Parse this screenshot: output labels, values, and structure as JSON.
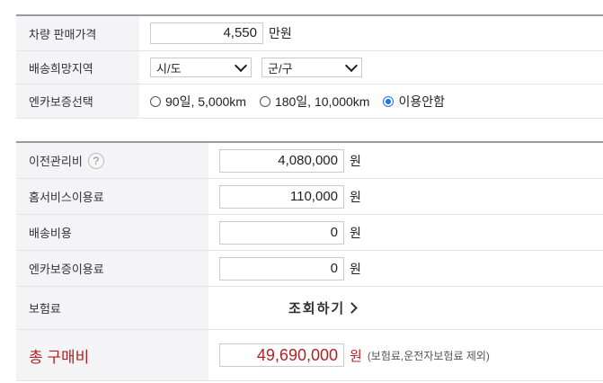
{
  "vehicle": {
    "price_label": "차량 판매가격",
    "price_value": "4,550",
    "price_unit": "만원",
    "region_label": "배송희망지역",
    "region_select1": "시/도",
    "region_select2": "군/구",
    "warranty_label": "엔카보증선택",
    "warranty_options": [
      "90일, 5,000km",
      "180일, 10,000km",
      "이용안함"
    ],
    "warranty_selected": "이용안함"
  },
  "fees": {
    "transfer_label": "이전관리비",
    "transfer_help": "?",
    "transfer_value": "4,080,000",
    "home_service_label": "홈서비스이용료",
    "home_service_value": "110,000",
    "delivery_label": "배송비용",
    "delivery_value": "0",
    "warranty_fee_label": "엔카보증이용료",
    "warranty_fee_value": "0",
    "insurance_label": "보험료",
    "insurance_link": "조회하기",
    "currency": "원"
  },
  "total": {
    "label": "총 구매비",
    "value": "49,690,000",
    "unit": "원",
    "note": "(보험료,운전자보험료 제외)"
  }
}
